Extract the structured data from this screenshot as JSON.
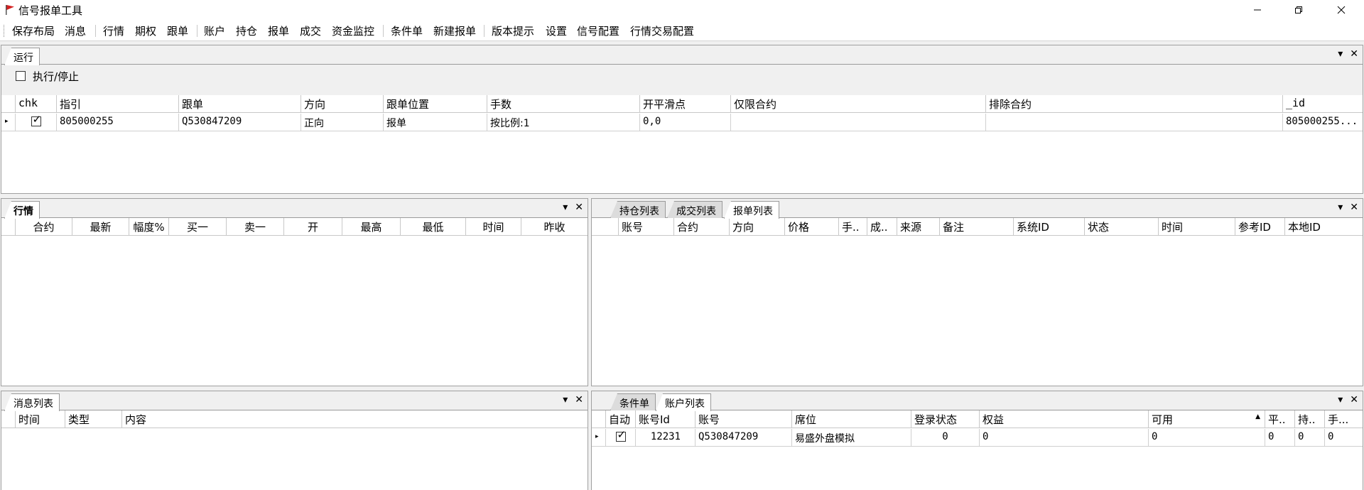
{
  "window": {
    "title": "信号报单工具",
    "icons": {
      "app": "red-flag-icon",
      "minimize": "minimize-icon",
      "maximize": "restore-icon",
      "close": "close-icon"
    }
  },
  "menu": [
    "保存布局",
    "消息",
    "行情",
    "期权",
    "跟单",
    "账户",
    "持仓",
    "报单",
    "成交",
    "资金监控",
    "条件单",
    "新建报单",
    "版本提示",
    "设置",
    "信号配置",
    "行情交易配置"
  ],
  "run_panel": {
    "tab": "运行",
    "checkbox_label": "执行/停止",
    "checkbox_checked": false,
    "columns": [
      "chk",
      "指引",
      "跟单",
      "方向",
      "跟单位置",
      "手数",
      "开平滑点",
      "仅限合约",
      "排除合约",
      "_id"
    ],
    "rows": [
      {
        "chk": true,
        "指引": "805000255",
        "跟单": "Q530847209",
        "方向": "正向",
        "跟单位置": "报单",
        "手数": "按比例:1",
        "开平滑点": "0,0",
        "仅限合约": "",
        "排除合约": "",
        "_id": "805000255..."
      }
    ]
  },
  "market_panel": {
    "tab": "行情",
    "columns": [
      "合约",
      "最新",
      "幅度%",
      "买一",
      "卖一",
      "开",
      "最高",
      "最低",
      "时间",
      "昨收"
    ]
  },
  "order_panel": {
    "tabs": [
      "持仓列表",
      "成交列表",
      "报单列表"
    ],
    "active_tab": "报单列表",
    "columns": [
      "账号",
      "合约",
      "方向",
      "价格",
      "手..",
      "成..",
      "来源",
      "备注",
      "系统ID",
      "状态",
      "时间",
      "参考ID",
      "本地ID"
    ]
  },
  "message_panel": {
    "tab": "消息列表",
    "columns": [
      "时间",
      "类型",
      "内容"
    ]
  },
  "account_panel": {
    "tabs": [
      "条件单",
      "账户列表"
    ],
    "active_tab": "账户列表",
    "columns": [
      "自动",
      "账号Id",
      "账号",
      "席位",
      "登录状态",
      "权益",
      "可用",
      "平..",
      "持..",
      "手..."
    ],
    "sort_indicator": "▲",
    "rows": [
      {
        "自动": true,
        "账号Id": "12231",
        "账号": "Q530847209",
        "席位": "易盛外盘模拟",
        "登录状态": "0",
        "权益": "0",
        "可用": "0",
        "平": "0",
        "持": "0",
        "手": "0"
      }
    ]
  },
  "panel_controls": {
    "dropdown": "▾",
    "close": "✕",
    "row_indicator": "▸"
  }
}
